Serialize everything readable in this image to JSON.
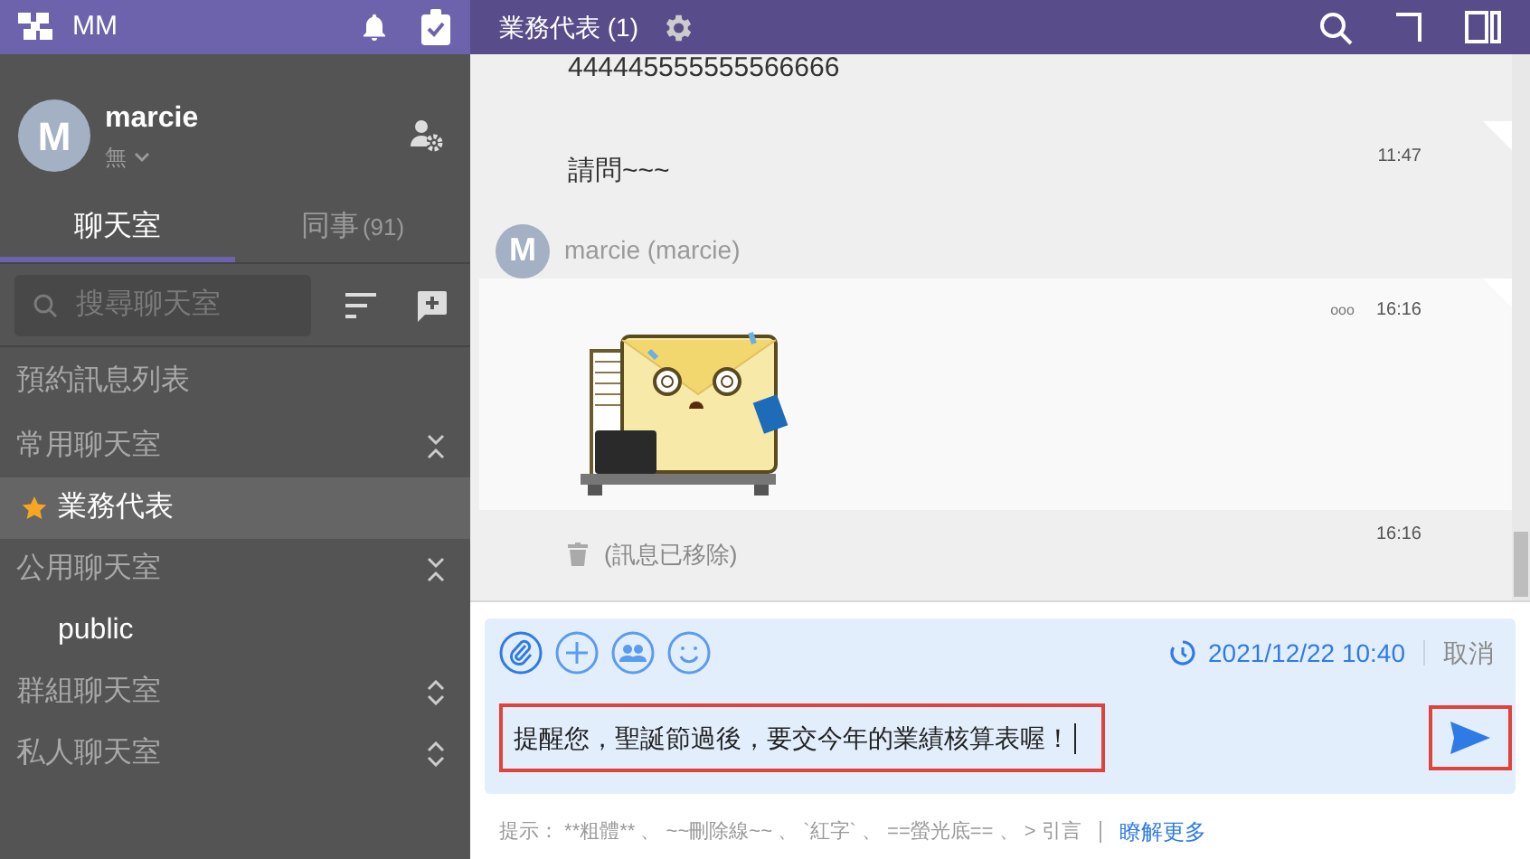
{
  "app": {
    "title": "MM"
  },
  "user": {
    "name": "marcie",
    "status": "無",
    "initial": "M"
  },
  "sidebar_tabs": [
    {
      "label": "聊天室",
      "selected": true
    },
    {
      "label": "同事",
      "count": "(91)",
      "selected": false
    }
  ],
  "search": {
    "placeholder": "搜尋聊天室"
  },
  "sidebar_items": [
    {
      "kind": "link",
      "label": "預約訊息列表"
    },
    {
      "kind": "section",
      "label": "常用聊天室",
      "expanded": true,
      "children": [
        {
          "label": "業務代表",
          "starred": true,
          "selected": true
        }
      ]
    },
    {
      "kind": "section",
      "label": "公用聊天室",
      "expanded": true,
      "children": [
        {
          "label": "public",
          "starred": false,
          "selected": false
        }
      ]
    },
    {
      "kind": "section",
      "label": "群組聊天室",
      "expanded": false
    },
    {
      "kind": "section",
      "label": "私人聊天室",
      "expanded": false
    }
  ],
  "chat": {
    "title": "業務代表 (1)"
  },
  "messages": [
    {
      "kind": "text",
      "text": "444445555555566666"
    },
    {
      "kind": "text",
      "text": "請問~~~",
      "time": "11:47"
    },
    {
      "kind": "sender",
      "initial": "M",
      "name": "marcie (marcie)"
    },
    {
      "kind": "sticker",
      "time": "16:16",
      "more": "ooo"
    },
    {
      "kind": "deleted",
      "text": "(訊息已移除)",
      "time": "16:16"
    }
  ],
  "composer": {
    "scheduled_time": "2021/12/22 10:40",
    "cancel": "取消",
    "value": "提醒您，聖誕節過後，要交今年的業績核算表喔！",
    "input_highlighted": true,
    "send_highlighted": true
  },
  "hint": {
    "text": "提示： **粗體** 、 ~~刪除線~~ 、 `紅字` 、 ==螢光底== 、 > 引言",
    "link": "瞭解更多"
  }
}
